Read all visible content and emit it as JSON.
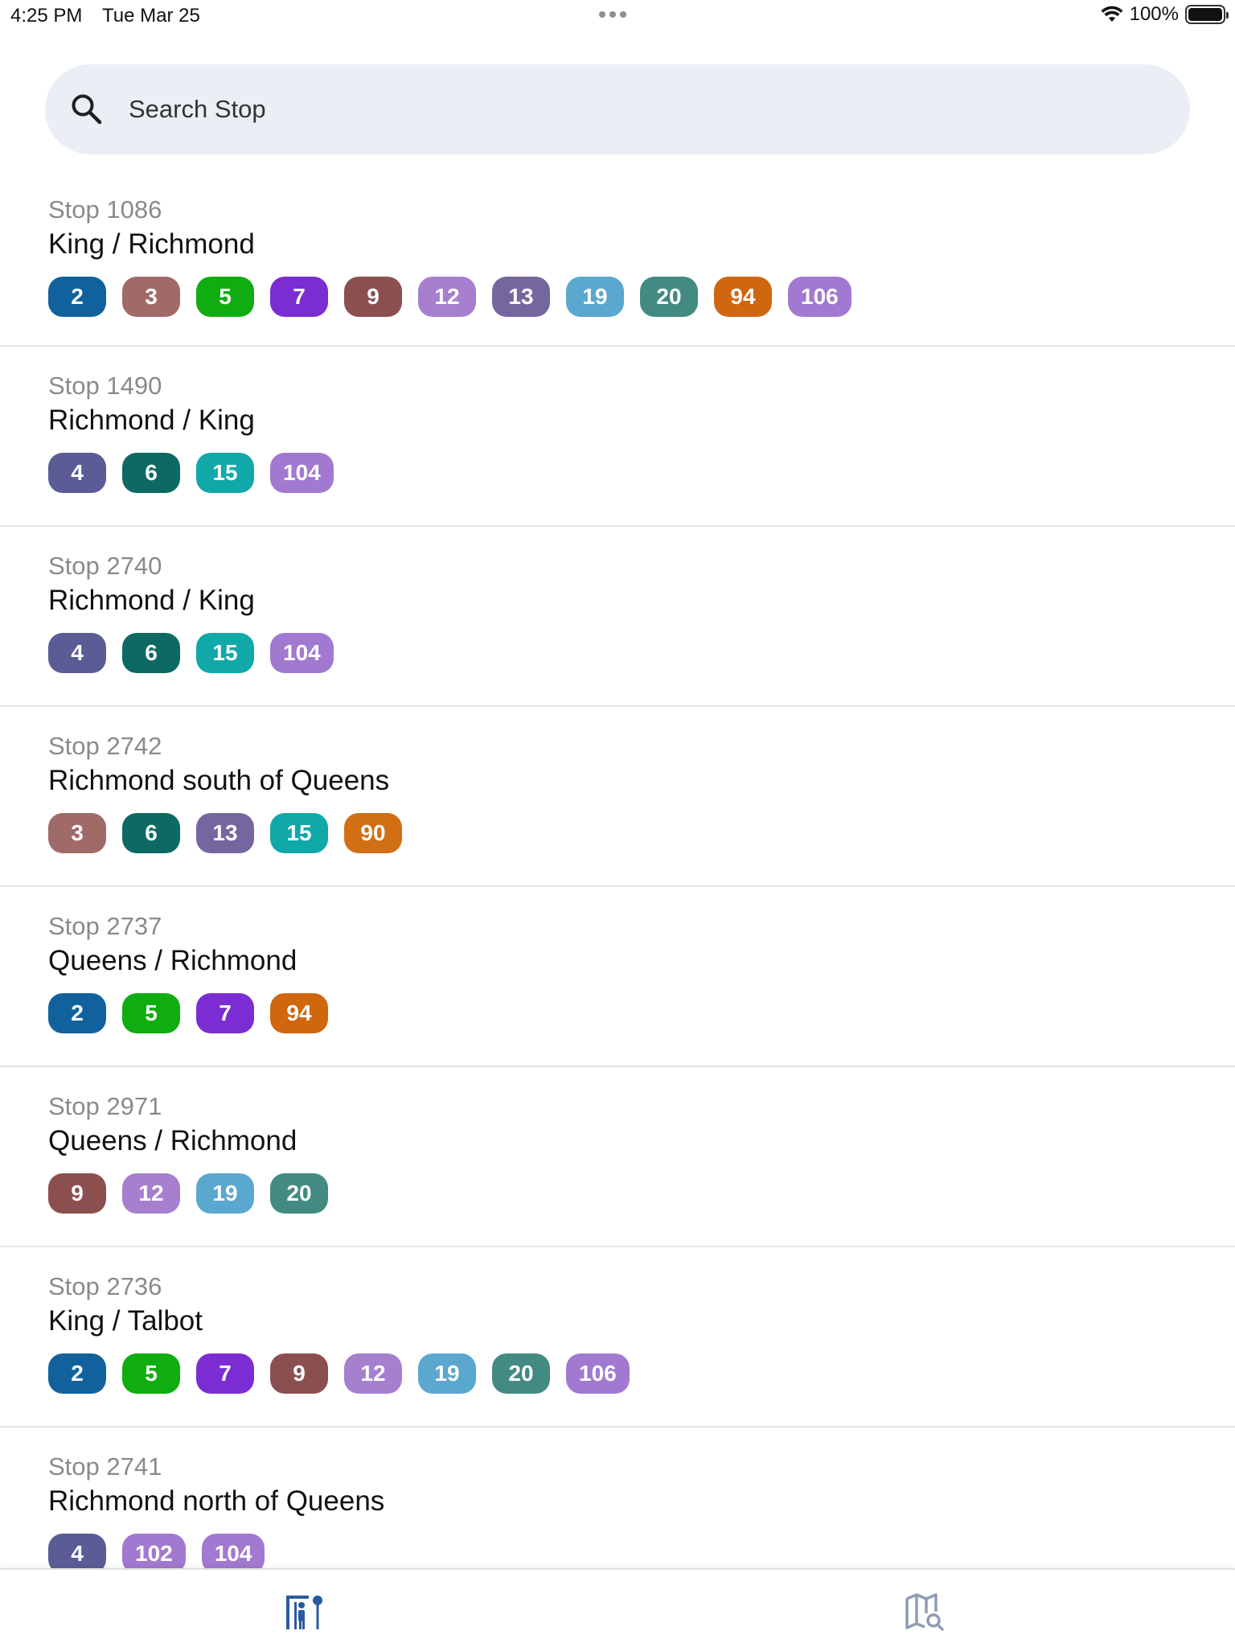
{
  "status_bar": {
    "time": "4:25 PM",
    "date": "Tue Mar 25",
    "battery": "100%",
    "battery_level": 1.0
  },
  "search": {
    "placeholder": "Search Stop",
    "value": ""
  },
  "route_colors": {
    "2": "#11619d",
    "3": "#a06a68",
    "4": "#5b5b96",
    "5": "#0fad0f",
    "6": "#0c6a62",
    "7": "#7b2cd2",
    "9": "#8c4f4f",
    "12": "#a77fcf",
    "13": "#7566a0",
    "15": "#10a8a8",
    "19": "#5aa7cf",
    "20": "#428a82",
    "90": "#d06f14",
    "94": "#d0660e",
    "102": "#a279d0",
    "104": "#a279d0",
    "106": "#a279d0"
  },
  "stops": [
    {
      "id": "Stop 1086",
      "name": "King / Richmond",
      "routes": [
        "2",
        "3",
        "5",
        "7",
        "9",
        "12",
        "13",
        "19",
        "20",
        "94",
        "106"
      ]
    },
    {
      "id": "Stop 1490",
      "name": "Richmond / King",
      "routes": [
        "4",
        "6",
        "15",
        "104"
      ]
    },
    {
      "id": "Stop 2740",
      "name": "Richmond / King",
      "routes": [
        "4",
        "6",
        "15",
        "104"
      ]
    },
    {
      "id": "Stop 2742",
      "name": "Richmond south of Queens",
      "routes": [
        "3",
        "6",
        "13",
        "15",
        "90"
      ]
    },
    {
      "id": "Stop 2737",
      "name": "Queens / Richmond",
      "routes": [
        "2",
        "5",
        "7",
        "94"
      ]
    },
    {
      "id": "Stop 2971",
      "name": "Queens / Richmond",
      "routes": [
        "9",
        "12",
        "19",
        "20"
      ]
    },
    {
      "id": "Stop 2736",
      "name": "King / Talbot",
      "routes": [
        "2",
        "5",
        "7",
        "9",
        "12",
        "19",
        "20",
        "106"
      ]
    },
    {
      "id": "Stop 2741",
      "name": "Richmond north of Queens",
      "routes": [
        "4",
        "102",
        "104"
      ]
    }
  ],
  "tab_bar": {
    "tabs": [
      {
        "icon": "bus-stop-icon",
        "active": true,
        "color": "#2b5a9e"
      },
      {
        "icon": "map-search-icon",
        "active": false,
        "color": "#8f9db3"
      }
    ]
  }
}
